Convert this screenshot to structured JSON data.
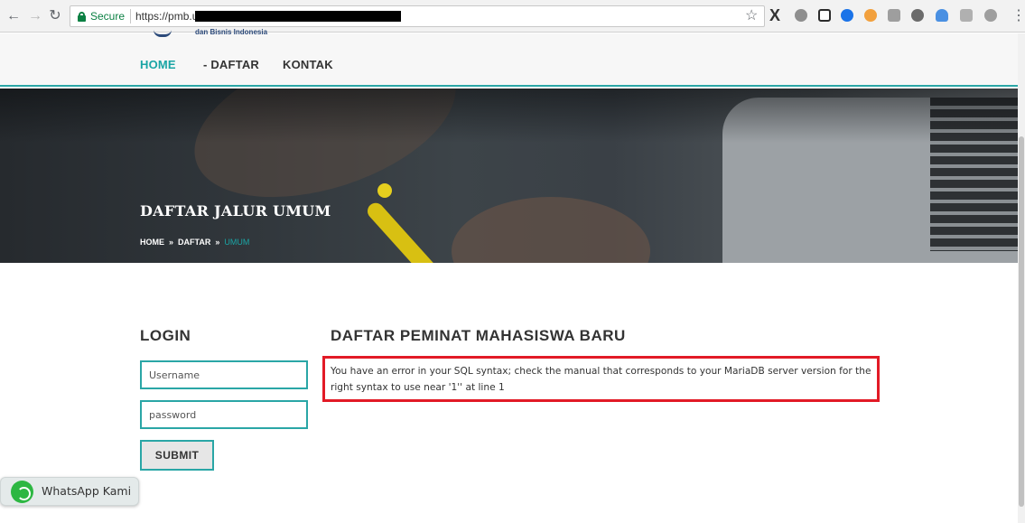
{
  "browser": {
    "secure_label": "Secure",
    "url_visible": "https://pmb.u",
    "extension_colors": [
      "#8e8e8e",
      "#2b2b2b",
      "#1a73e8",
      "#f2a03d",
      "#9e9e9e",
      "#6b6b6b",
      "#4a90e2",
      "#b0b0b0",
      "#9e9e9e"
    ]
  },
  "site": {
    "tagline": "dan Bisnis Indonesia",
    "nav": {
      "home": "HOME",
      "daftar": "- DAFTAR",
      "kontak": "KONTAK"
    }
  },
  "hero": {
    "title": "DAFTAR JALUR UMUM",
    "breadcrumb": {
      "home": "HOME",
      "sep": "»",
      "daftar": "DAFTAR",
      "current": "UMUM"
    }
  },
  "login": {
    "title": "LOGIN",
    "username_placeholder": "Username",
    "password_placeholder": "password",
    "submit_label": "SUBMIT"
  },
  "main": {
    "title": "DAFTAR PEMINAT MAHASISWA BARU",
    "error_message": "You have an error in your SQL syntax; check the manual that corresponds to your MariaDB server version for the right syntax to use near '1'' at line 1"
  },
  "whatsapp": {
    "label": "WhatsApp Kami"
  },
  "colors": {
    "accent": "#2aa6a6",
    "error_border": "#e21a26",
    "whatsapp": "#2db742"
  }
}
